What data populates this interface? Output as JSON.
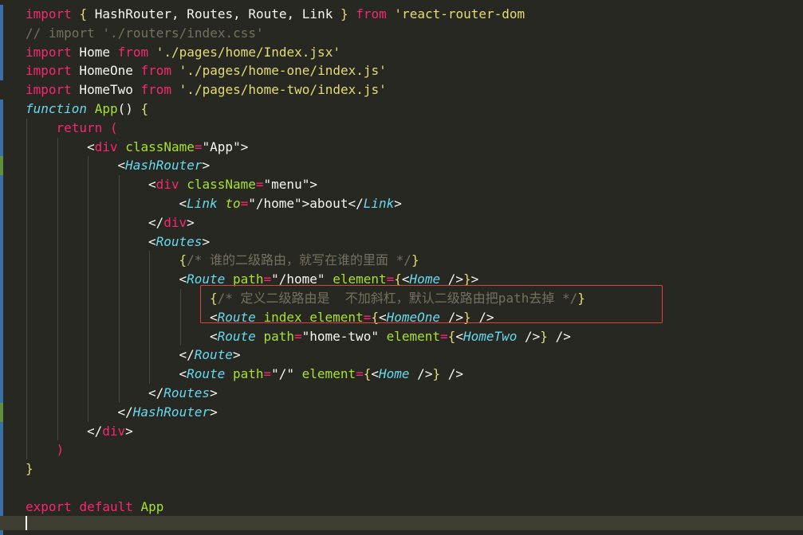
{
  "editor": {
    "lines": [
      {
        "indent": 0,
        "tokens": [
          [
            "kw",
            "import"
          ],
          [
            "pl",
            " "
          ],
          [
            "brY",
            "{"
          ],
          [
            "pl",
            " HashRouter, Routes, Route, Link "
          ],
          [
            "brY",
            "}"
          ],
          [
            "pl",
            " "
          ],
          [
            "kw",
            "from"
          ],
          [
            "pl",
            " "
          ],
          [
            "str",
            "'react-router-dom"
          ]
        ]
      },
      {
        "indent": 0,
        "tokens": [
          [
            "cmt",
            "// import './routers/index.css'"
          ]
        ]
      },
      {
        "indent": 0,
        "tokens": [
          [
            "kw",
            "import"
          ],
          [
            "pl",
            " Home "
          ],
          [
            "kw",
            "from"
          ],
          [
            "pl",
            " "
          ],
          [
            "str",
            "'./pages/home/Index.jsx'"
          ]
        ]
      },
      {
        "indent": 0,
        "tokens": [
          [
            "kw",
            "import"
          ],
          [
            "pl",
            " HomeOne "
          ],
          [
            "kw",
            "from"
          ],
          [
            "pl",
            " "
          ],
          [
            "str",
            "'./pages/home-one/index.js'"
          ]
        ]
      },
      {
        "indent": 0,
        "tokens": [
          [
            "kw",
            "import"
          ],
          [
            "pl",
            " HomeTwo "
          ],
          [
            "kw",
            "from"
          ],
          [
            "pl",
            " "
          ],
          [
            "str",
            "'./pages/home-two/index.js'"
          ]
        ]
      },
      {
        "indent": 0,
        "tokens": [
          [
            "fn-kw",
            "function"
          ],
          [
            "pl",
            " "
          ],
          [
            "fn",
            "App"
          ],
          [
            "pl",
            "() "
          ],
          [
            "brY",
            "{"
          ]
        ]
      },
      {
        "indent": 1,
        "tokens": [
          [
            "kw",
            "return"
          ],
          [
            "pl",
            " "
          ],
          [
            "brP",
            "("
          ]
        ]
      },
      {
        "indent": 2,
        "tokens": [
          [
            "pl",
            "<"
          ],
          [
            "tag",
            "div"
          ],
          [
            "pl",
            " "
          ],
          [
            "attr",
            "className"
          ],
          [
            "op",
            "="
          ],
          [
            "pl",
            "\"App\">"
          ]
        ]
      },
      {
        "indent": 3,
        "tokens": [
          [
            "pl",
            "<"
          ],
          [
            "jsx",
            "HashRouter"
          ],
          [
            "pl",
            ">"
          ]
        ]
      },
      {
        "indent": 4,
        "tokens": [
          [
            "pl",
            "<"
          ],
          [
            "tag",
            "div"
          ],
          [
            "pl",
            " "
          ],
          [
            "attr",
            "className"
          ],
          [
            "op",
            "="
          ],
          [
            "pl",
            "\"menu\">"
          ]
        ]
      },
      {
        "indent": 5,
        "tokens": [
          [
            "pl",
            "<"
          ],
          [
            "jsx",
            "Link"
          ],
          [
            "pl",
            " "
          ],
          [
            "attr-i",
            "to"
          ],
          [
            "op",
            "="
          ],
          [
            "pl",
            "\"/home\">about</"
          ],
          [
            "jsx",
            "Link"
          ],
          [
            "pl",
            ">"
          ]
        ]
      },
      {
        "indent": 4,
        "tokens": [
          [
            "pl",
            "</"
          ],
          [
            "tag",
            "div"
          ],
          [
            "pl",
            ">"
          ]
        ]
      },
      {
        "indent": 4,
        "tokens": [
          [
            "pl",
            "<"
          ],
          [
            "jsx",
            "Routes"
          ],
          [
            "pl",
            ">"
          ]
        ]
      },
      {
        "indent": 5,
        "tokens": [
          [
            "brY",
            "{"
          ],
          [
            "cmt",
            "/* 谁的二级路由，就写在谁的里面 */"
          ],
          [
            "brY",
            "}"
          ]
        ]
      },
      {
        "indent": 5,
        "tokens": [
          [
            "pl",
            "<"
          ],
          [
            "jsx",
            "Route"
          ],
          [
            "pl",
            " "
          ],
          [
            "attr",
            "path"
          ],
          [
            "op",
            "="
          ],
          [
            "pl",
            "\"/home\" "
          ],
          [
            "attr",
            "element"
          ],
          [
            "op",
            "="
          ],
          [
            "brY",
            "{"
          ],
          [
            "pl",
            "<"
          ],
          [
            "jsx",
            "Home"
          ],
          [
            "pl",
            " />"
          ],
          [
            "brY",
            "}"
          ],
          [
            "pl",
            ">"
          ]
        ]
      },
      {
        "indent": 6,
        "tokens": [
          [
            "brY",
            "{"
          ],
          [
            "cmt",
            "/* 定义二级路由是  不加斜杠，默认二级路由把path去掉 */"
          ],
          [
            "brY",
            "}"
          ]
        ]
      },
      {
        "indent": 6,
        "tokens": [
          [
            "pl",
            "<"
          ],
          [
            "jsx",
            "Route"
          ],
          [
            "pl",
            " "
          ],
          [
            "attr",
            "index"
          ],
          [
            "pl",
            " "
          ],
          [
            "attr",
            "element"
          ],
          [
            "op",
            "="
          ],
          [
            "brY",
            "{"
          ],
          [
            "pl",
            "<"
          ],
          [
            "jsx",
            "HomeOne"
          ],
          [
            "pl",
            " />"
          ],
          [
            "brY",
            "}"
          ],
          [
            "pl",
            " />"
          ]
        ]
      },
      {
        "indent": 6,
        "tokens": [
          [
            "pl",
            "<"
          ],
          [
            "jsx",
            "Route"
          ],
          [
            "pl",
            " "
          ],
          [
            "attr",
            "path"
          ],
          [
            "op",
            "="
          ],
          [
            "pl",
            "\"home-two\" "
          ],
          [
            "attr",
            "element"
          ],
          [
            "op",
            "="
          ],
          [
            "brY",
            "{"
          ],
          [
            "pl",
            "<"
          ],
          [
            "jsx",
            "HomeTwo"
          ],
          [
            "pl",
            " />"
          ],
          [
            "brY",
            "}"
          ],
          [
            "pl",
            " />"
          ]
        ]
      },
      {
        "indent": 5,
        "tokens": [
          [
            "pl",
            "</"
          ],
          [
            "jsx",
            "Route"
          ],
          [
            "pl",
            ">"
          ]
        ]
      },
      {
        "indent": 5,
        "tokens": [
          [
            "pl",
            "<"
          ],
          [
            "jsx",
            "Route"
          ],
          [
            "pl",
            " "
          ],
          [
            "attr",
            "path"
          ],
          [
            "op",
            "="
          ],
          [
            "pl",
            "\"/\" "
          ],
          [
            "attr",
            "element"
          ],
          [
            "op",
            "="
          ],
          [
            "brY",
            "{"
          ],
          [
            "pl",
            "<"
          ],
          [
            "jsx",
            "Home"
          ],
          [
            "pl",
            " />"
          ],
          [
            "brY",
            "}"
          ],
          [
            "pl",
            " />"
          ]
        ]
      },
      {
        "indent": 4,
        "tokens": [
          [
            "pl",
            "</"
          ],
          [
            "jsx",
            "Routes"
          ],
          [
            "pl",
            ">"
          ]
        ]
      },
      {
        "indent": 3,
        "tokens": [
          [
            "pl",
            "</"
          ],
          [
            "jsx",
            "HashRouter"
          ],
          [
            "pl",
            ">"
          ]
        ]
      },
      {
        "indent": 2,
        "tokens": [
          [
            "pl",
            "</"
          ],
          [
            "tag",
            "div"
          ],
          [
            "pl",
            ">"
          ]
        ]
      },
      {
        "indent": 1,
        "tokens": [
          [
            "brP",
            ")"
          ]
        ]
      },
      {
        "indent": 0,
        "tokens": [
          [
            "brY",
            "}"
          ]
        ]
      },
      {
        "indent": 0,
        "tokens": []
      },
      {
        "indent": 0,
        "tokens": [
          [
            "kw",
            "export"
          ],
          [
            "pl",
            " "
          ],
          [
            "kw",
            "default"
          ],
          [
            "pl",
            " "
          ],
          [
            "fn",
            "App"
          ]
        ]
      }
    ]
  }
}
